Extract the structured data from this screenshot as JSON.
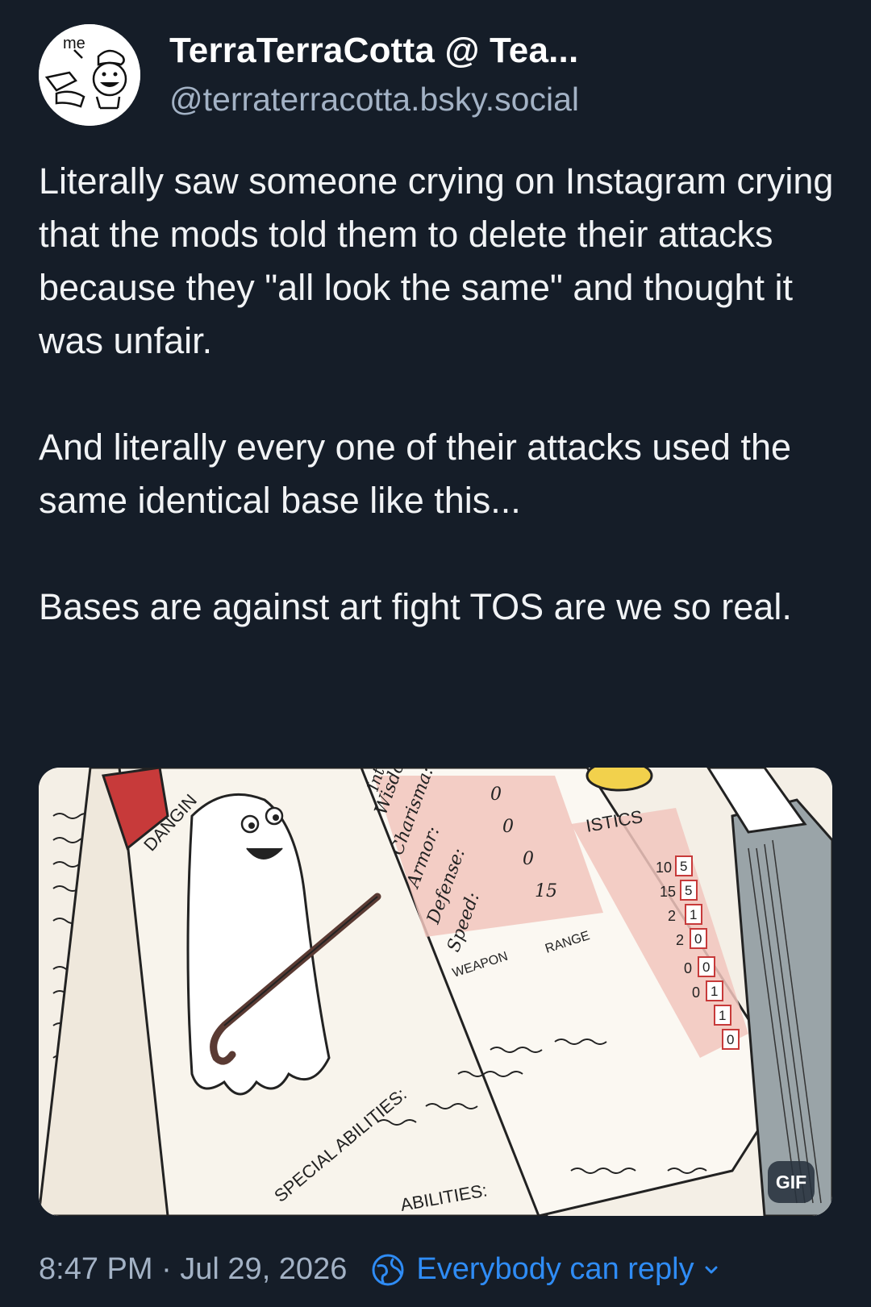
{
  "post": {
    "author": {
      "display_name": "TerraTerraCotta @ Tea...",
      "handle": "@terraterracotta.bsky.social",
      "avatar_text": "me"
    },
    "paragraphs": [
      "Literally saw someone crying on Instagram crying that the mods told them to delete their attacks because they \"all look the same\" and thought it was unfair.",
      "And literally every one of their attacks used the same identical base like this...",
      "Bases are against art fight TOS are we so real."
    ],
    "media": {
      "type": "gif",
      "badge": "GIF",
      "sheet_text": {
        "dangin": "DANGIN",
        "stats": [
          "Intel",
          "Wisdom:",
          "Charisma:",
          "Armor:",
          "Defense:",
          "Speed:"
        ],
        "stat_values": [
          "0",
          "0",
          "0",
          "15"
        ],
        "weapon": "WEAPON",
        "range": "RANGE",
        "istics": "ISTICS",
        "right_values": [
          "10",
          "15",
          "2",
          "2",
          "0",
          "0"
        ],
        "boxed_digits": [
          "5",
          "5",
          "1",
          "0",
          "0",
          "1",
          "1",
          "0"
        ],
        "special_abilities": "SPECIAL ABILITIES:",
        "abilities": "ABILITIES:"
      }
    },
    "footer": {
      "timestamp": "8:47 PM · Jul 29, 2026",
      "reply_setting": "Everybody can reply"
    }
  },
  "colors": {
    "background": "#151d28",
    "text": "#f1f3f5",
    "muted": "#a3b2c5",
    "accent": "#2f8cf5"
  },
  "icons": [
    "globe-icon",
    "chevron-down-icon"
  ]
}
